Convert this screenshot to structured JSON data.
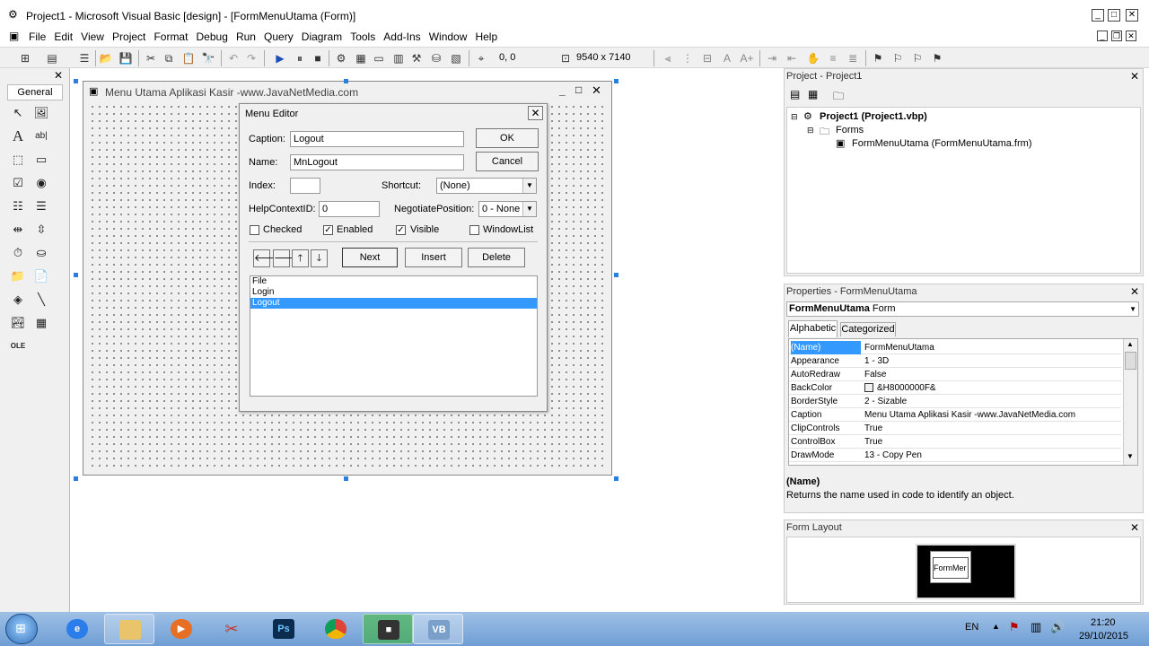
{
  "window": {
    "title": "Project1 - Microsoft Visual Basic [design] - [FormMenuUtama (Form)]",
    "minimize": "_",
    "maximize": "□",
    "close": "✕"
  },
  "menubar": [
    "File",
    "Edit",
    "View",
    "Project",
    "Format",
    "Debug",
    "Run",
    "Query",
    "Diagram",
    "Tools",
    "Add-Ins",
    "Window",
    "Help"
  ],
  "toolbar": {
    "position_readout": "0, 0",
    "size_readout": "9540 x 7140"
  },
  "toolbox": {
    "tab_label": "General",
    "close": "✕"
  },
  "form": {
    "caption": "Menu Utama Aplikasi Kasir -www.JavaNetMedia.com"
  },
  "menu_editor": {
    "title": "Menu Editor",
    "close": "✕",
    "caption_label": "Caption:",
    "caption_value": "Logout",
    "name_label": "Name:",
    "name_value": "MnLogout",
    "index_label": "Index:",
    "index_value": "",
    "shortcut_label": "Shortcut:",
    "shortcut_value": "(None)",
    "helpcontext_label": "HelpContextID:",
    "helpcontext_value": "0",
    "negotiate_label": "NegotiatePosition:",
    "negotiate_value": "0 - None",
    "ok_label": "OK",
    "cancel_label": "Cancel",
    "checked_label": "Checked",
    "enabled_label": "Enabled",
    "visible_label": "Visible",
    "windowlist_label": "WindowList",
    "checked": false,
    "enabled": true,
    "visible": true,
    "windowlist": false,
    "next_label": "Next",
    "insert_label": "Insert",
    "delete_label": "Delete",
    "items": [
      "File",
      "Login",
      "Logout"
    ],
    "selected_index": 2
  },
  "project_panel": {
    "title": "Project - Project1",
    "root": "Project1 (Project1.vbp)",
    "folder": "Forms",
    "form_file": "FormMenuUtama (FormMenuUtama.frm)"
  },
  "properties_panel": {
    "title": "Properties - FormMenuUtama",
    "object_name": "FormMenuUtama",
    "object_type": "Form",
    "tab_alphabetic": "Alphabetic",
    "tab_categorized": "Categorized",
    "rows": [
      {
        "key": "(Name)",
        "value": "FormMenuUtama"
      },
      {
        "key": "Appearance",
        "value": "1 - 3D"
      },
      {
        "key": "AutoRedraw",
        "value": "False"
      },
      {
        "key": "BackColor",
        "value": "&H8000000F&"
      },
      {
        "key": "BorderStyle",
        "value": "2 - Sizable"
      },
      {
        "key": "Caption",
        "value": "Menu Utama Aplikasi Kasir -www.JavaNetMedia.com"
      },
      {
        "key": "ClipControls",
        "value": "True"
      },
      {
        "key": "ControlBox",
        "value": "True"
      },
      {
        "key": "DrawMode",
        "value": "13 - Copy Pen"
      }
    ],
    "desc_title": "(Name)",
    "desc_text": "Returns the name used in code to identify an object."
  },
  "form_layout_panel": {
    "title": "Form Layout",
    "preview_label": "FormMer"
  },
  "taskbar": {
    "language": "EN",
    "time": "21:20",
    "date": "29/10/2015",
    "ps_label": "Ps"
  },
  "colors": {
    "selection": "#3399ff",
    "taskbar": "#7fa9d9"
  }
}
